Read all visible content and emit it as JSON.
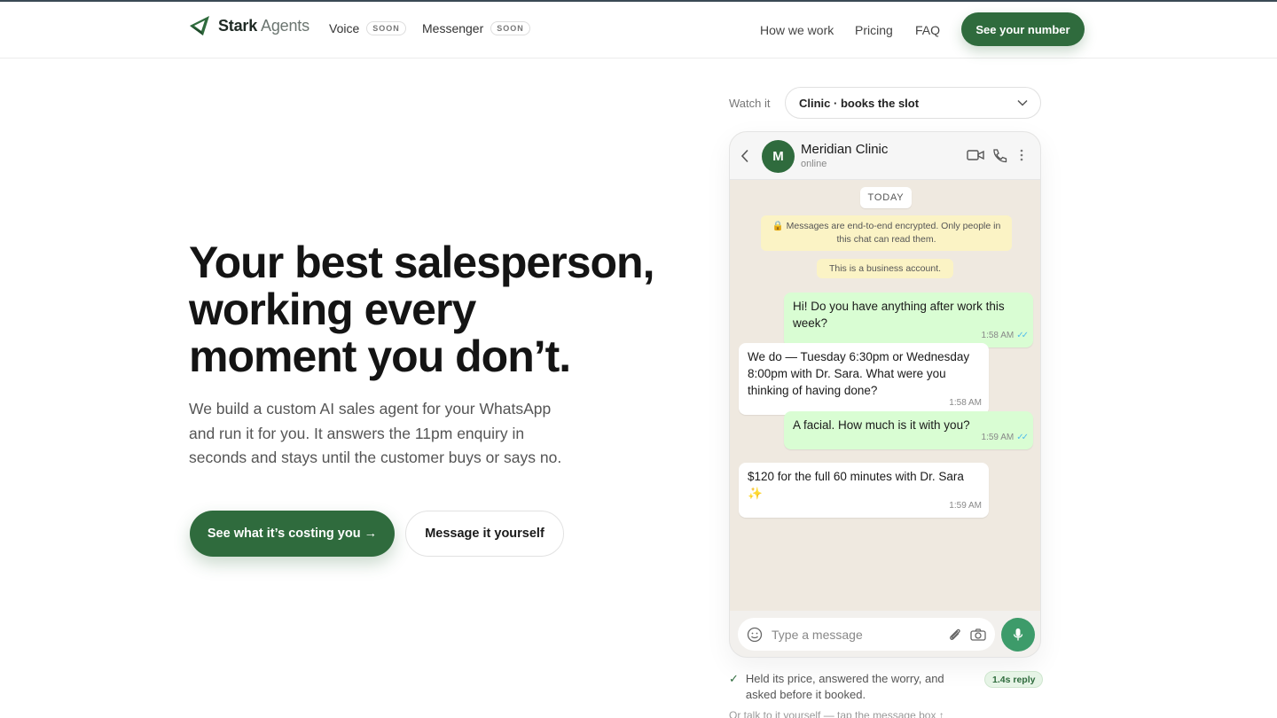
{
  "brand": {
    "name_strong": "Stark",
    "name_light": "Agents",
    "color": "#2f6b3d"
  },
  "nav": {
    "voice": {
      "label": "Voice",
      "badge": "SOON"
    },
    "messenger": {
      "label": "Messenger",
      "badge": "SOON"
    },
    "how_we_work": "How we work",
    "pricing": "Pricing",
    "faq": "FAQ",
    "cta": "See your number"
  },
  "hero": {
    "title_line1": "Your best salesperson,",
    "title_line2": "working every",
    "title_line3": "moment you don’t.",
    "subtitle": "We build a custom AI sales agent for your WhatsApp and run it for you. It answers the 11pm enquiry in seconds and stays until the customer buys or says no.",
    "primary_button": "See what it’s costing you →",
    "secondary_button": "Message it yourself"
  },
  "demo": {
    "watch_label": "Watch it",
    "scenario_selected": "Clinic · books the slot",
    "chat": {
      "contact_name": "Meridian Clinic",
      "contact_status": "online",
      "avatar_letter": "M",
      "day_label": "TODAY",
      "encryption_notice": "🔒 Messages are end-to-end encrypted. Only people in this chat can read them.",
      "business_notice": "This is a business account.",
      "messages": [
        {
          "direction": "out",
          "text": "Hi! Do you have anything after work this week?",
          "time": "1:58 AM",
          "ticks": "✓✓"
        },
        {
          "direction": "in",
          "text": "We do — Tuesday 6:30pm or Wednesday 8:00pm with Dr. Sara. What were you thinking of having done?",
          "time": "1:58 AM"
        },
        {
          "direction": "out",
          "text": "A facial. How much is it with you?",
          "time": "1:59 AM",
          "ticks": "✓✓"
        },
        {
          "direction": "in",
          "text": "$120 for the full 60 minutes with Dr. Sara ✨",
          "time": "1:59 AM"
        }
      ],
      "composer_placeholder": "Type a message"
    },
    "result_text": "Held its price, answered the worry, and asked before it booked.",
    "reply_badge": "1.4s reply",
    "footer_hint": "Or talk to it yourself — tap the message box ↑"
  }
}
